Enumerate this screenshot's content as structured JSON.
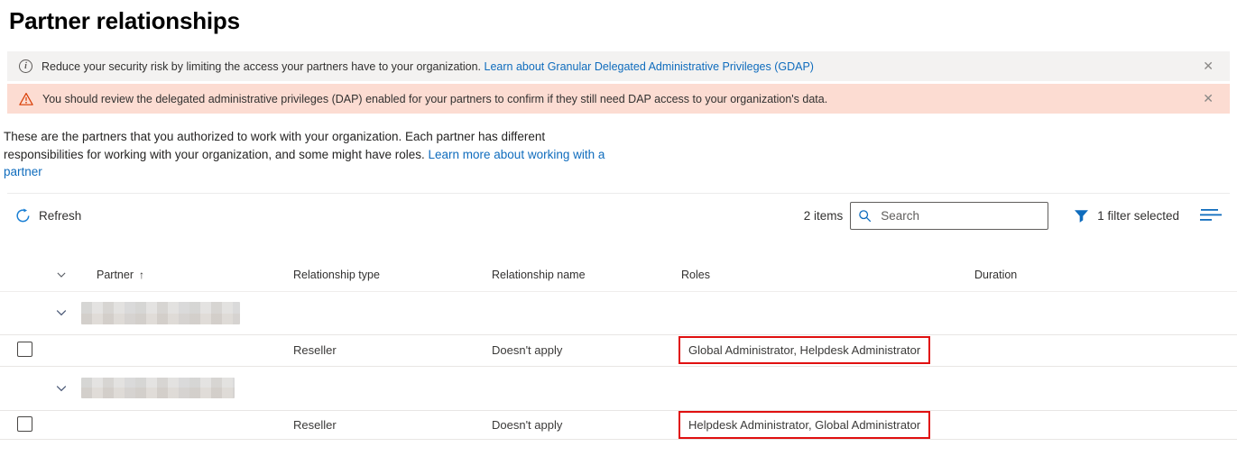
{
  "page": {
    "title": "Partner relationships"
  },
  "banners": {
    "info": {
      "icon_glyph": "i",
      "text": "Reduce your security risk by limiting the access your partners have to your organization.",
      "link": "Learn about Granular Delegated Administrative Privileges (GDAP)"
    },
    "warning": {
      "text": "You should review the delegated administrative privileges (DAP) enabled for your partners to confirm if they still need DAP access to your organization's data."
    },
    "close_glyph": "✕"
  },
  "intro": {
    "text": "These are the partners that you authorized to work with your organization. Each partner has different responsibilities for working with your organization, and some might have roles.",
    "link": "Learn more about working with a partner"
  },
  "toolbar": {
    "refresh_label": "Refresh",
    "items_count": "2 items",
    "search_placeholder": "Search",
    "filter_label": "1 filter selected"
  },
  "table": {
    "columns": {
      "partner": "Partner",
      "relationship_type": "Relationship type",
      "relationship_name": "Relationship name",
      "roles": "Roles",
      "duration": "Duration"
    },
    "sort": {
      "column": "Partner",
      "direction": "ascending",
      "arrow_glyph": "↑"
    },
    "rows": [
      {
        "type": "group",
        "partner_redacted": true,
        "expanded": true
      },
      {
        "type": "item",
        "relationship_type": "Reseller",
        "relationship_name": "Doesn't apply",
        "roles": "Global Administrator, Helpdesk Administrator",
        "roles_annotated": true,
        "duration": ""
      },
      {
        "type": "group",
        "partner_redacted": true,
        "expanded": true
      },
      {
        "type": "item",
        "relationship_type": "Reseller",
        "relationship_name": "Doesn't apply",
        "roles": "Helpdesk Administrator, Global Administrator",
        "roles_annotated": true,
        "duration": ""
      }
    ]
  },
  "colors": {
    "accent_blue": "#0f6cbd",
    "info_banner_bg": "#f3f2f1",
    "warning_banner_bg": "#fcdcd2",
    "warning_icon": "#d83b01",
    "annotation_red": "#e01010"
  }
}
